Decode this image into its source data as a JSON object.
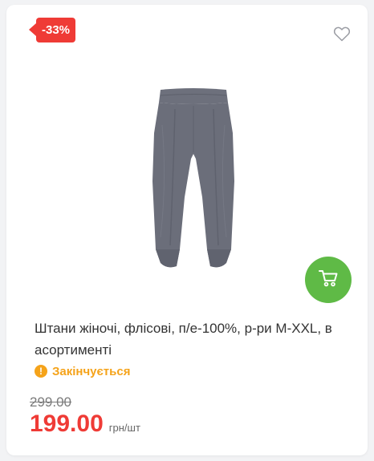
{
  "product": {
    "discount_badge": "-33%",
    "title": "Штани жіночі, флісові, п/е-100%, р-ри M-XXL, в асортименті",
    "status": "Закінчується",
    "old_price": "299.00",
    "price": "199.00",
    "unit": "грн/шт"
  },
  "icons": {
    "favorite": "heart-outline-icon",
    "cart": "cart-icon",
    "status": "exclamation-circle-icon"
  },
  "colors": {
    "accent_red": "#ef3b36",
    "cart_green": "#5fba46",
    "status_orange": "#f5a31a",
    "product_gray": "#6b6e7a"
  }
}
